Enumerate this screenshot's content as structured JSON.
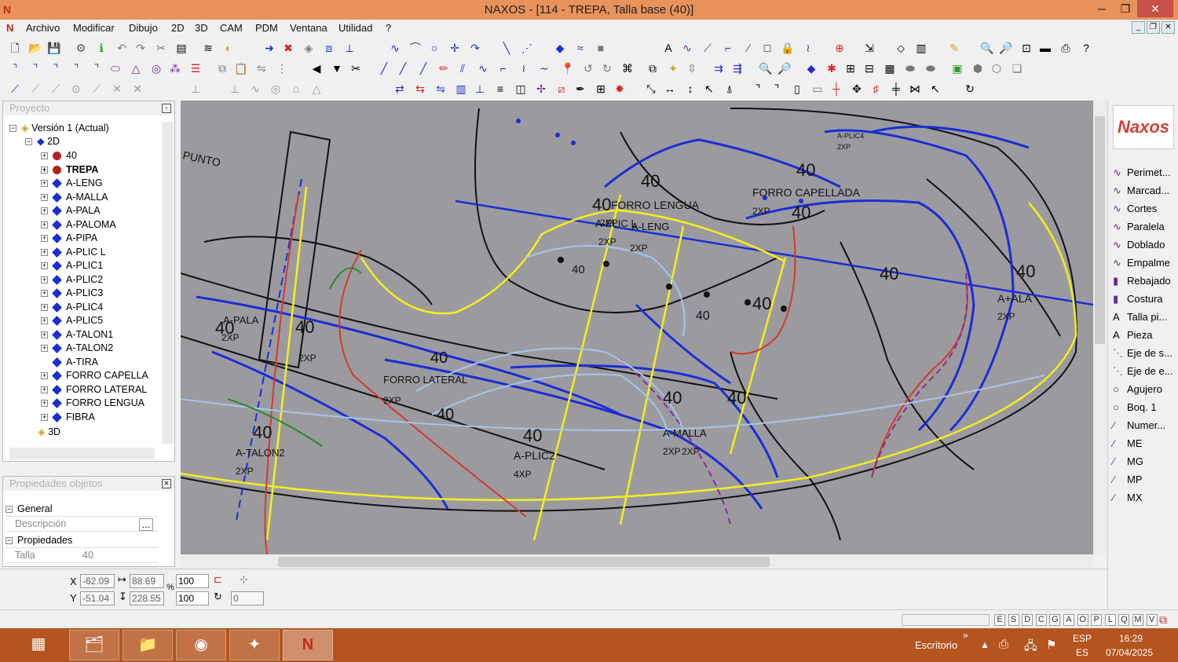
{
  "title": "NAXOS - [114 - TREPA, Talla base (40)]",
  "menu": [
    "Archivo",
    "Modificar",
    "Dibujo",
    "2D",
    "3D",
    "CAM",
    "PDM",
    "Ventana",
    "Utilidad",
    "?"
  ],
  "project_panel": {
    "title": "Proyecto",
    "root": "Versión 1 (Actual)",
    "group_2d": "2D",
    "items": [
      "40",
      "TREPA",
      "A-LENG",
      "A-MALLA",
      "A-PALA",
      "A-PALOMA",
      "A-PIPA",
      "A-PLIC L",
      "A-PLIC1",
      "A-PLIC2",
      "A-PLIC3",
      "A-PLIC4",
      "A-PLIC5",
      "A-TALON1",
      "A-TALON2",
      "A-TIRA",
      "FORRO CAPELLA",
      "FORRO LATERAL",
      "FORRO LENGUA",
      "FIBRA"
    ],
    "group_3d": "3D"
  },
  "props_panel": {
    "title": "Propiedades objetos",
    "general": "General",
    "descripcion_label": "Descripción",
    "descripcion_btn": "...",
    "propiedades": "Propiedades",
    "talla_label": "Talla",
    "talla_value": "40"
  },
  "canvas_labels": [
    "40",
    "40",
    "FORRO LENGUA",
    "FORRO CAPELLADA",
    "2XP",
    "40",
    "2XP",
    "A-PLIC L",
    "A-LENG",
    "2XP",
    "2XP",
    "40",
    "40",
    "40",
    "40",
    "A-PLIC4",
    "2XP",
    "40",
    "A+ALA",
    "2XP",
    "40",
    "A-PALA",
    "2XP",
    "40",
    "40",
    "2XP",
    "40",
    "FORRO LATERAL",
    "2XP",
    "40",
    "40",
    "40",
    "40",
    "A-TALON2",
    "2XP",
    "40",
    "A-PLIC2",
    "4XP",
    "A-MALLA",
    "2XP",
    "2XP",
    "PUNTO"
  ],
  "tools": [
    "Perimet...",
    "Marcad...",
    "Cortes",
    "Paralela",
    "Doblado",
    "Empalme",
    "Rebajado",
    "Costura",
    "Talla pi...",
    "Pieza",
    "Eje de s...",
    "Eje de e...",
    "Agujero",
    "Boq. 1",
    "Numer...",
    "ME",
    "MG",
    "MP",
    "MX"
  ],
  "logo": "Naxos",
  "coords": {
    "x_label": "X",
    "y_label": "Y",
    "x": "-62.09",
    "y": "-51.04",
    "w": "88.69",
    "h": "228.55",
    "pct_x": "100",
    "pct_y": "100",
    "pct_sign": "%",
    "rot": "0"
  },
  "status_keys": [
    "E",
    "S",
    "D",
    "C",
    "G",
    "A",
    "O",
    "P",
    "L",
    "Q",
    "M",
    "V"
  ],
  "taskbar": {
    "desktop_label": "Escritorio",
    "lang1": "ESP",
    "lang2": "ES",
    "time": "16:29",
    "date": "07/04/2025"
  },
  "colors": {
    "titlebar": "#e8925c",
    "taskbar": "#b4541e",
    "canvas": "#9b9b9f",
    "layer_blue": "#1c2dd6",
    "layer_yellow": "#f4ef1a",
    "layer_red": "#d33a2a"
  }
}
